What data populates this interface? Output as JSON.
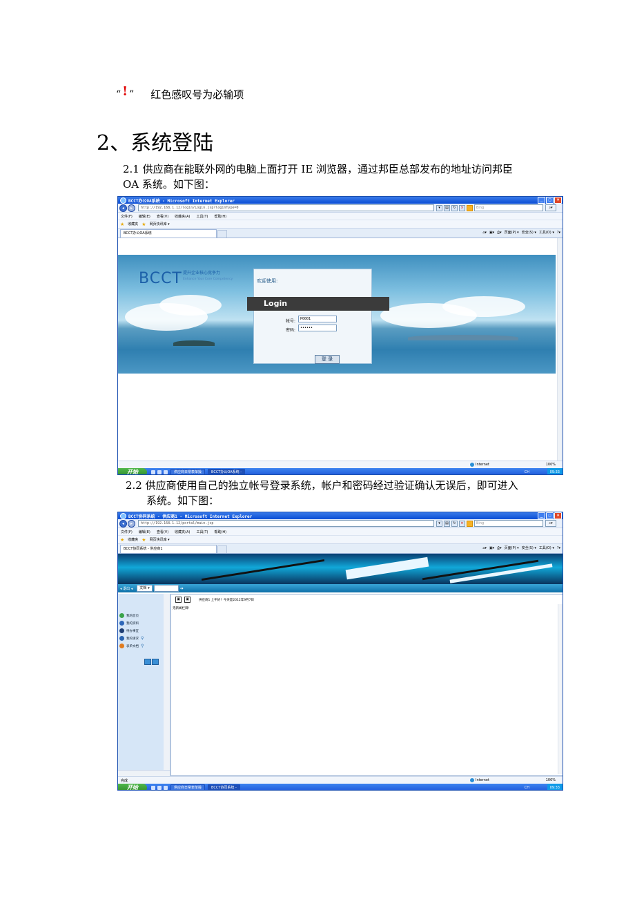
{
  "legend": {
    "quote_open": "“",
    "mark": "!",
    "quote_close": "”",
    "text": "红色感叹号为必输项"
  },
  "section": {
    "heading": "2、系统登陆"
  },
  "step1": {
    "line1": "2.1 供应商在能联外网的电脑上面打开 IE 浏览器，通过邦臣总部发布的地址访问邦臣",
    "line2": "OA 系统。如下图："
  },
  "step2": {
    "line1": "2.2 供应商使用自己的独立帐号登录系统，帐户和密码经过验证确认无误后，即可进入",
    "line2": "系统。如下图："
  },
  "browser": {
    "menus": [
      "文件(F)",
      "编辑(E)",
      "查看(V)",
      "收藏夹(A)",
      "工具(T)",
      "帮助(H)"
    ],
    "favorites_label": "收藏夹",
    "favorites_link": "网页快讯库 ▾",
    "search_placeholder": "Bing",
    "command_items": [
      "页面(P) ▾",
      "安全(S) ▾",
      "工具(O) ▾"
    ],
    "status_zone": "Internet",
    "zoom": "100%",
    "start_label": "开始",
    "taskbar_task1": "供应商日常表单操",
    "taskbar_lang": "CH",
    "taskbar_time": "09:33"
  },
  "screenshot1": {
    "window_title": "BCCT办公OA系统 - Microsoft Internet Explorer",
    "url": "http://192.168.1.12/login/Login.jsp?loginType=0",
    "tab_label": "BCCT办公OA系统",
    "taskbar_task2": "BCCT办公OA系统 -",
    "logo": "BCCT",
    "slogan_cn": "提升企业核心竞争力",
    "slogan_en": "Enhance Your Core Competency",
    "welcome": "欢迎使用:",
    "login_title": "Login",
    "account_label": "帐号:",
    "account_value": "P0001",
    "password_label": "密码:",
    "password_value": "••••••",
    "login_button": "登 录"
  },
  "screenshot2": {
    "window_title": "BCCT协同系统 - 供应商1 - Microsoft Internet Explorer",
    "url": "http://192.168.1.12/portal/main.jsp",
    "tab_label": "BCCT协同系统 - 供应商1",
    "taskbar_task2": "BCCT协同系统 -",
    "nav_left": "◂ 退出 ◂",
    "doc_select": "文档",
    "menu": [
      "我的首页",
      "我的资料",
      "待办事宜",
      "我的请求",
      "表单文档"
    ],
    "main_greeting": "供应商1 上午好！今天是2012年9月7日",
    "no_columns": "无新闻栏目!",
    "status_done": "完成"
  },
  "colors": {
    "required_mark": "#e00000",
    "ie_title": "#0b4ed6",
    "oa_banner": "#11a7d8",
    "oa_sidebar": "#d6e6f7"
  }
}
